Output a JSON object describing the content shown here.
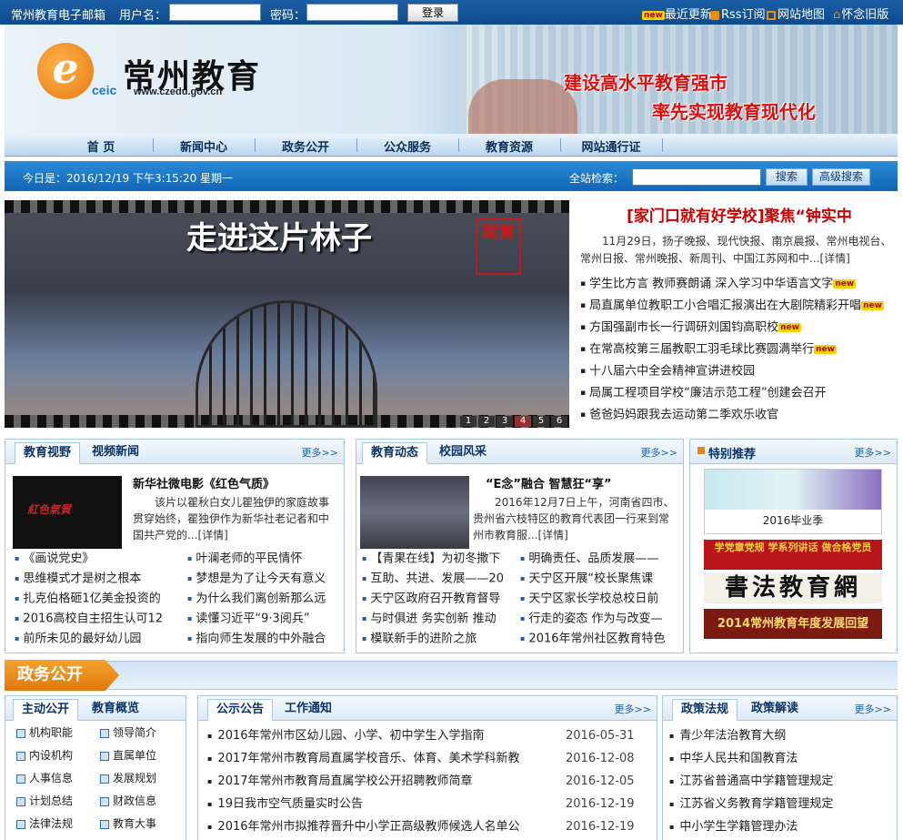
{
  "topbar": {
    "mail": "常州教育电子邮箱",
    "user_label": "用户名：",
    "pass_label": "密码：",
    "login": "登录",
    "new_badge": "new",
    "latest": "最近更新",
    "rss": "Rss订阅",
    "sitemap": "网站地图",
    "old": "怀念旧版"
  },
  "banner": {
    "logo_letter": "e",
    "ceic": "ceic",
    "brand": "常州教育",
    "url": "www.czedu.gov.cn",
    "slogan1": "建设高水平教育强市",
    "slogan2": "率先实现教育现代化"
  },
  "nav": [
    "首 页",
    "新闻中心",
    "政务公开",
    "公众服务",
    "教育资源",
    "网站通行证"
  ],
  "datebar": {
    "date": "今日是：2016/12/19 下午3:15:20 星期一",
    "search_label": "全站检索：",
    "search_btn": "搜索",
    "adv_btn": "高级搜索"
  },
  "slide": {
    "title": "走进这片林子",
    "seal": "賦實",
    "pages": [
      "1",
      "2",
      "3",
      "4",
      "5",
      "6"
    ],
    "active": 3
  },
  "headline": {
    "title": "[家门口就有好学校]聚焦“钟实中",
    "desc": "11月29日，扬子晚报、现代快报、南京晨报、常州电视台、常州日报、常州晚报、新周刊、中国江苏网和中...[详情]"
  },
  "news": [
    {
      "t": "学生比方言 教师赛朗诵 深入学习中华语言文字",
      "new": true
    },
    {
      "t": "局直属单位教职工小合唱汇报演出在大剧院精彩开唱",
      "new": true
    },
    {
      "t": "方国强副市长一行调研刘国钧高职校",
      "new": true
    },
    {
      "t": "在常高校第三届教职工羽毛球比赛圆满举行",
      "new": true
    },
    {
      "t": "十八届六中全会精神宣讲进校园",
      "new": false
    },
    {
      "t": "局属工程项目学校“廉洁示范工程”创建会召开",
      "new": false
    },
    {
      "t": "爸爸妈妈跟我去运动第二季欢乐收官",
      "new": false
    }
  ],
  "more": "更多>>",
  "panel1": {
    "tabs": [
      "教育视野",
      "视频新闻"
    ],
    "feat_img_text": "紅色氣質",
    "feat_title": "新华社微电影《红色气质》",
    "feat_desc": "该片以瞿秋白女儿瞿独伊的家庭故事贯穿始终，瞿独伊作为新华社老记者和中国共产党的...[详情]",
    "items": [
      "《画说党史》",
      "叶澜老师的平民情怀",
      "思维模式才是树之根本",
      "梦想是为了让今天有意义",
      "扎克伯格砸1亿美金投资的",
      "为什么我们离创新那么远",
      "2016高校自主招生认可12",
      "读懂习近平“9·3阅兵”",
      "前所未见的最好幼儿园",
      "指向师生发展的中外融合"
    ]
  },
  "panel2": {
    "tabs": [
      "教育动态",
      "校园风采"
    ],
    "feat_title": "“E念”融合 智慧狂“享”",
    "feat_desc": "2016年12月7日上午，河南省四市、贵州省六枝特区的教育代表团一行来到常州市教育服...[详情]",
    "items": [
      "【青果在线】为初冬撒下",
      "明确责任、品质发展——",
      "互助、共进、发展——20",
      "天宁区开展“校长聚焦课",
      "天宁区政府召开教育督导",
      "天宁区家长学校总校日前",
      "与时俱进 务实创新 推动",
      "行走的姿态 作为与改变—",
      "模联新手的进阶之旅",
      "2016年常州社区教育特色"
    ]
  },
  "special": {
    "title": "特别推荐",
    "card": "2016毕业季",
    "ad1": "学党章党规 学系列讲话 做合格党员",
    "ad2": "書法教育網",
    "ad3": "2014常州教育年度发展回望"
  },
  "section_title": "政务公开",
  "gov": {
    "tabs": [
      "主动公开",
      "教育概览"
    ],
    "links": [
      "机构职能",
      "领导简介",
      "内设机构",
      "直属单位",
      "人事信息",
      "发展规划",
      "计划总结",
      "财政信息",
      "法律法规",
      "教育大事"
    ]
  },
  "notice": {
    "tabs": [
      "公示公告",
      "工作通知"
    ],
    "items": [
      {
        "t": "2016年常州市区幼儿园、小学、初中学生入学指南",
        "d": "2016-05-31"
      },
      {
        "t": "2017年常州市教育局直属学校音乐、体育、美术学科新教",
        "d": "2016-12-08"
      },
      {
        "t": "2017年常州市教育局直属学校公开招聘教师简章",
        "d": "2016-12-05"
      },
      {
        "t": "19日我市空气质量实时公告",
        "d": "2016-12-19"
      },
      {
        "t": "2016年常州市拟推荐晋升中小学正高级教师候选人名单公",
        "d": "2016-12-19"
      }
    ]
  },
  "law": {
    "tabs": [
      "政策法规",
      "政策解读"
    ],
    "items": [
      "青少年法治教育大纲",
      "中华人民共和国教育法",
      "江苏省普通高中学籍管理规定",
      "江苏省义务教育学籍管理规定",
      "中小学生学籍管理办法"
    ]
  }
}
